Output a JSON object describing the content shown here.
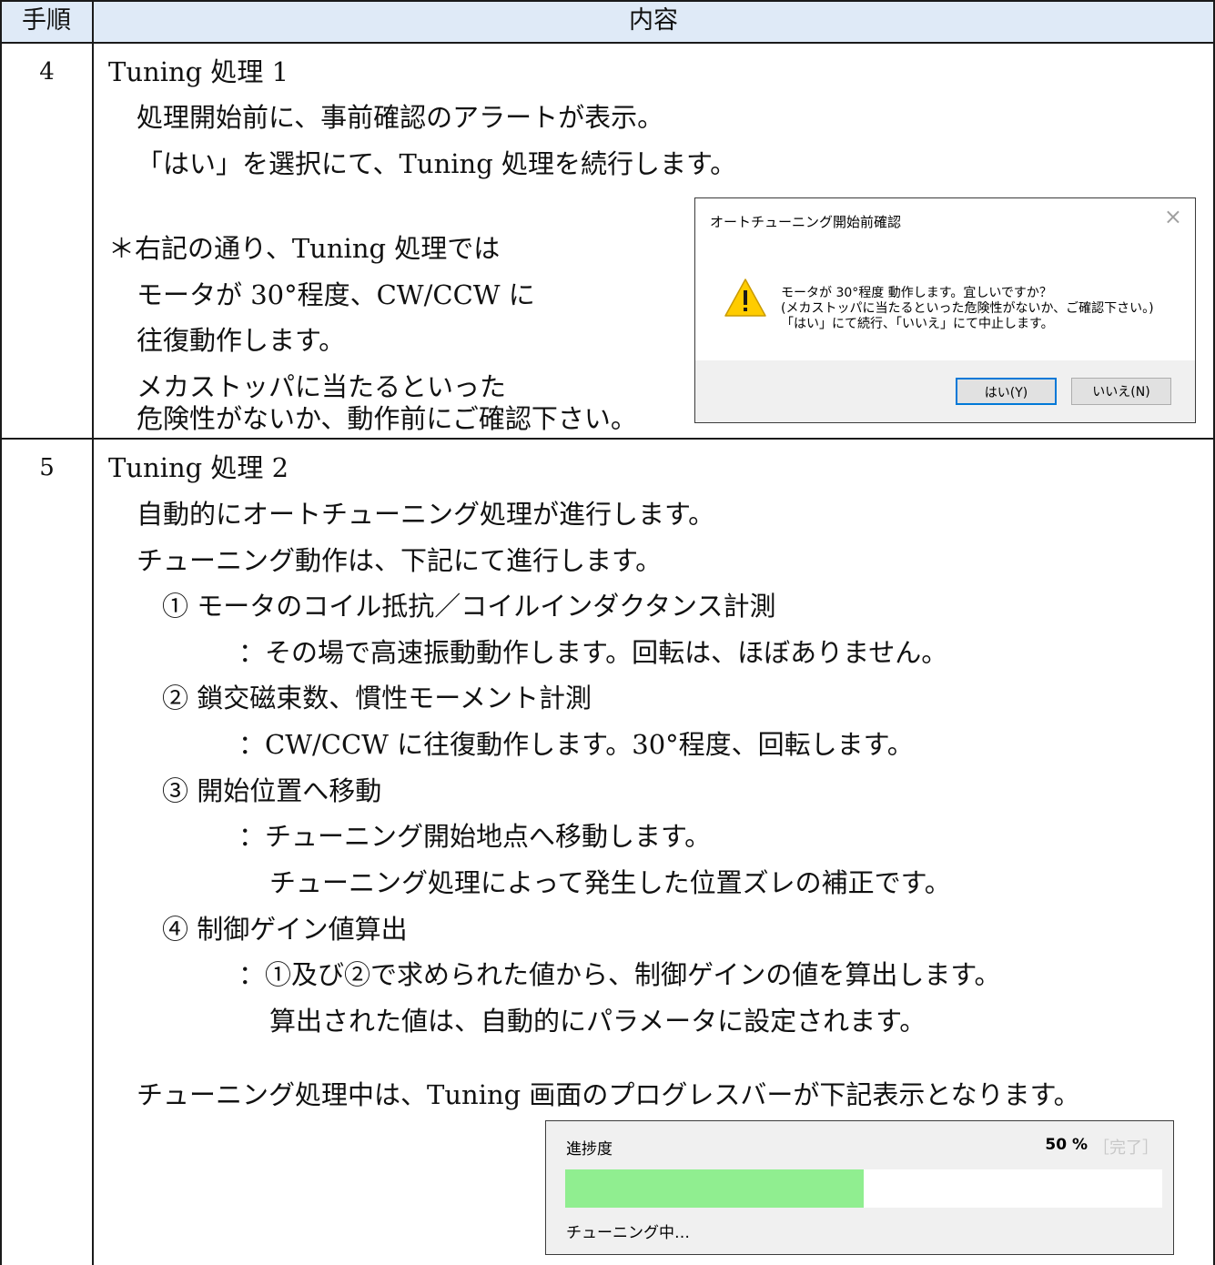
{
  "header": {
    "col_step": "手順",
    "col_content": "内容"
  },
  "step4": {
    "number": "4",
    "title": "Tuning 処理 1",
    "lines": [
      "処理開始前に、事前確認のアラートが表示。",
      "「はい」を選択にて、Tuning 処理を続行します。"
    ],
    "note": [
      "＊右記の通り、Tuning 処理では",
      "モータが 30°程度、CW/CCW に",
      "往復動作します。",
      "メカストッパに当たるといった",
      "危険性がないか、動作前にご確認下さい。"
    ],
    "dialog": {
      "title": "オートチューニング開始前確認",
      "close": "×",
      "icon": "warning-icon",
      "message": [
        "モータが 30°程度 動作します。宜しいですか？",
        "(メカストッパに当たるといった危険性がないか、ご確認下さい。)",
        "「はい」にて続行、「いいえ」にて中止します。"
      ],
      "yes_label": "はい(Y)",
      "no_label": "いいえ(N)"
    }
  },
  "step5": {
    "number": "5",
    "title": "Tuning 処理 2",
    "lines": [
      "自動的にオートチューニング処理が進行します。",
      "チューニング動作は、下記にて進行します。"
    ],
    "items": [
      {
        "head": "① モータのコイル抵抗／コイルインダクタンス計測",
        "desc": [
          "：その場で高速振動動作します。回転は、ほぼありません。"
        ]
      },
      {
        "head": "② 鎖交磁束数、慣性モーメント計測",
        "desc": [
          "：CW/CCW に往復動作します。30°程度、回転します。"
        ]
      },
      {
        "head": "③ 開始位置へ移動",
        "desc": [
          "：チューニング開始地点へ移動します。",
          "チューニング処理によって発生した位置ズレの補正です。"
        ]
      },
      {
        "head": "④ 制御ゲイン値算出",
        "desc": [
          "：①及び②で求められた値から、制御ゲインの値を算出します。",
          "算出された値は、自動的にパラメータに設定されます。"
        ]
      }
    ],
    "progress_intro": "チューニング処理中は、Tuning 画面のプログレスバーが下記表示となります。",
    "progress": {
      "label": "進捗度",
      "percent_text": "50 %",
      "done_text": "［完了］",
      "value": 0.5,
      "status": "チューニング中…",
      "fill_color": "#90ee90"
    }
  }
}
